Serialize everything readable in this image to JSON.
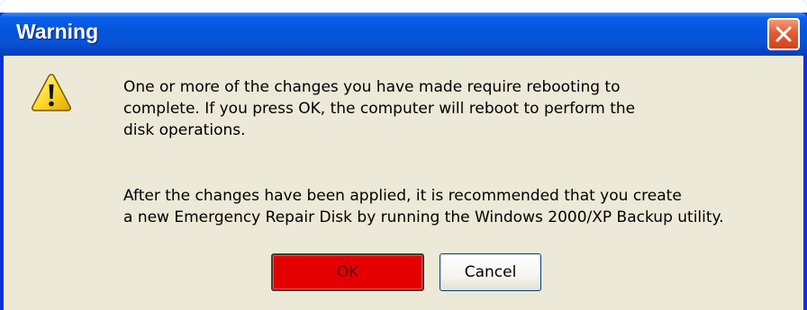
{
  "window": {
    "title": "Warning",
    "strip_text": "{ · · · · · · · · · · · · · · · · · · · · · · · · · · · }"
  },
  "icons": {
    "warning": "warning-icon",
    "close": "close-icon"
  },
  "message": {
    "paragraph1": [
      "One or more of the changes you have made require rebooting to",
      "complete. If you press OK, the computer will reboot to perform the",
      "disk operations."
    ],
    "paragraph2": [
      "After the changes have been applied, it is recommended that you create",
      "a new Emergency Repair Disk by running the Windows 2000/XP Backup utility."
    ]
  },
  "buttons": {
    "ok": "OK",
    "cancel": "Cancel"
  },
  "colors": {
    "titlebar": "#0555dd",
    "ok_highlight": "#e40000",
    "close": "#e35d32",
    "dialog_bg": "#ece9d8"
  }
}
